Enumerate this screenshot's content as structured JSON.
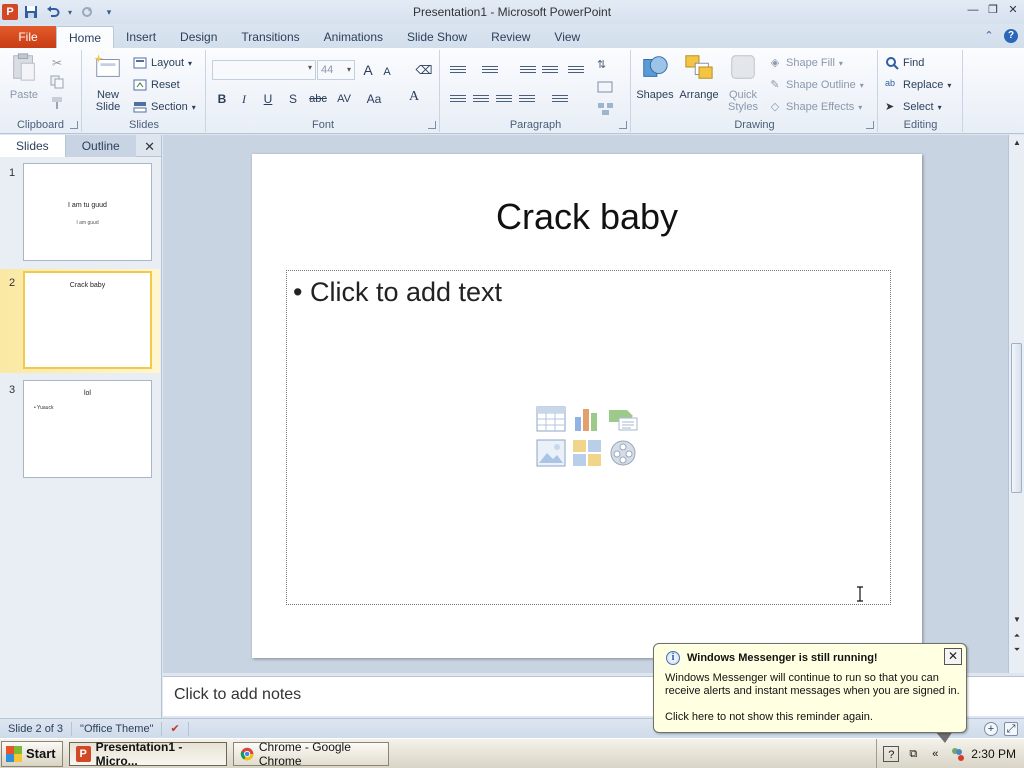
{
  "window": {
    "title": "Presentation1  -  Microsoft PowerPoint",
    "app_icon_letter": "P"
  },
  "tabs": [
    "File",
    "Home",
    "Insert",
    "Design",
    "Transitions",
    "Animations",
    "Slide Show",
    "Review",
    "View"
  ],
  "active_tab": "Home",
  "ribbon": {
    "clipboard": {
      "label": "Clipboard",
      "paste": "Paste"
    },
    "slides": {
      "label": "Slides",
      "new_slide": "New Slide",
      "layout": "Layout",
      "reset": "Reset",
      "section": "Section"
    },
    "font": {
      "label": "Font",
      "font_name": "",
      "font_size": "44",
      "grow": "A",
      "shrink": "A",
      "bold": "B",
      "italic": "I",
      "underline": "U",
      "shadow": "S",
      "strike": "abc",
      "spacing": "AV",
      "case": "Aa",
      "color": "A"
    },
    "paragraph": {
      "label": "Paragraph"
    },
    "drawing": {
      "label": "Drawing",
      "shapes": "Shapes",
      "arrange": "Arrange",
      "quick_styles": "Quick Styles",
      "shape_fill": "Shape Fill",
      "shape_outline": "Shape Outline",
      "shape_effects": "Shape Effects"
    },
    "editing": {
      "label": "Editing",
      "find": "Find",
      "replace": "Replace",
      "select": "Select"
    }
  },
  "panel": {
    "tabs": [
      "Slides",
      "Outline"
    ],
    "close": "✕",
    "thumbnails": [
      {
        "num": "1",
        "title": "I am tu guud",
        "subtitle": "I am guud",
        "bullet": ""
      },
      {
        "num": "2",
        "title": "Crack baby",
        "subtitle": "",
        "bullet": ""
      },
      {
        "num": "3",
        "title": "lol",
        "subtitle": "",
        "bullet": "• Yuauck"
      }
    ]
  },
  "slide": {
    "title": "Crack baby",
    "content_placeholder": "• Click to add text"
  },
  "notes": {
    "placeholder": "Click to add notes"
  },
  "status": {
    "slide_info": "Slide 2 of 3",
    "theme": "\"Office Theme\""
  },
  "taskbar": {
    "start": "Start",
    "tasks": [
      {
        "label": "Presentation1 - Micro...",
        "active": true
      },
      {
        "label": "Chrome - Google Chrome",
        "active": false
      }
    ],
    "clock": "2:30 PM"
  },
  "balloon": {
    "title": "Windows Messenger is still running!",
    "body": "Windows Messenger will continue to run so that you can receive alerts and instant messages when you are signed in.",
    "link": "Click here to not show this reminder again.",
    "close": "✕"
  },
  "colors": {
    "file_tab": "#d24726",
    "accent": "#2b579a",
    "selection": "#f2c94c"
  }
}
